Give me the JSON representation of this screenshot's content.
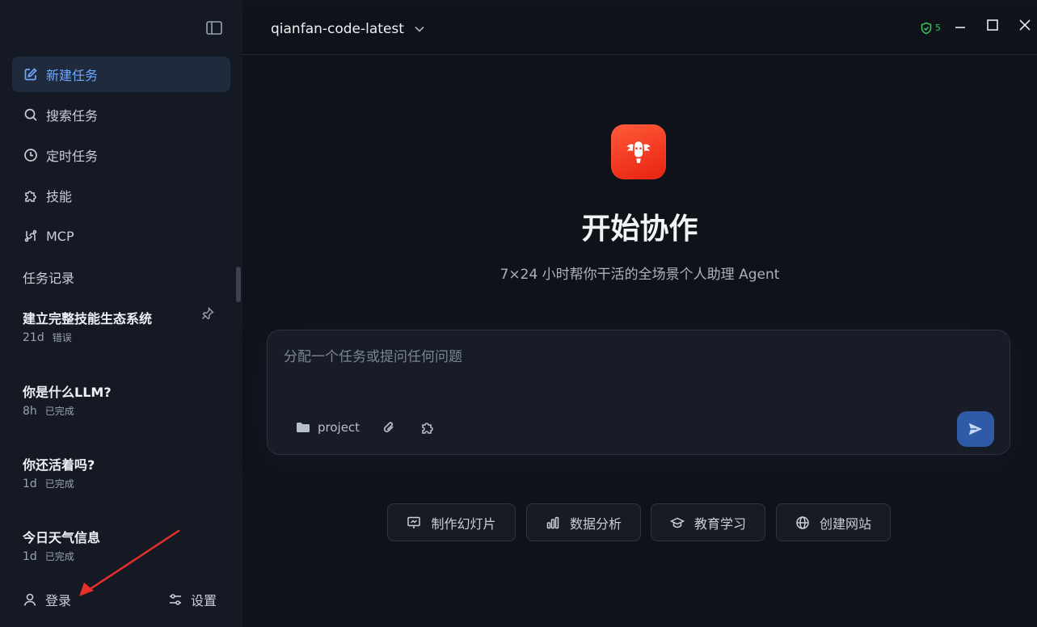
{
  "sidebar": {
    "toggle_icon": "sidebar-toggle-icon",
    "nav": [
      {
        "label": "新建任务",
        "icon": "edit-icon",
        "active": true
      },
      {
        "label": "搜索任务",
        "icon": "search-icon"
      },
      {
        "label": "定时任务",
        "icon": "clock-icon"
      },
      {
        "label": "技能",
        "icon": "puzzle-icon"
      },
      {
        "label": "MCP",
        "icon": "mcp-icon"
      }
    ],
    "history_title": "任务记录",
    "tasks": [
      {
        "title": "建立完整技能生态系统",
        "age": "21d",
        "status": "错误",
        "pinned": true
      },
      {
        "title": "你是什么LLM?",
        "age": "8h",
        "status": "已完成"
      },
      {
        "title": "你还活着吗?",
        "age": "1d",
        "status": "已完成"
      },
      {
        "title": "今日天气信息",
        "age": "1d",
        "status": "已完成"
      }
    ],
    "login_label": "登录",
    "settings_label": "设置"
  },
  "header": {
    "model": "qianfan-code-latest",
    "status_glyph": "5",
    "colors": {
      "status": "#3ac35e"
    }
  },
  "hero": {
    "title": "开始协作",
    "subtitle": "7×24 小时帮你干活的全场景个人助理 Agent"
  },
  "composer": {
    "placeholder": "分配一个任务或提问任何问题",
    "folder_label": "project"
  },
  "quick_actions": [
    {
      "label": "制作幻灯片",
      "icon": "presentation-icon"
    },
    {
      "label": "数据分析",
      "icon": "bar-chart-icon"
    },
    {
      "label": "教育学习",
      "icon": "graduation-cap-icon"
    },
    {
      "label": "创建网站",
      "icon": "globe-icon"
    }
  ],
  "colors": {
    "accent": "#6ea8ff",
    "send_button": "#2f5aa8",
    "annotation_arrow": "#e8302a"
  }
}
